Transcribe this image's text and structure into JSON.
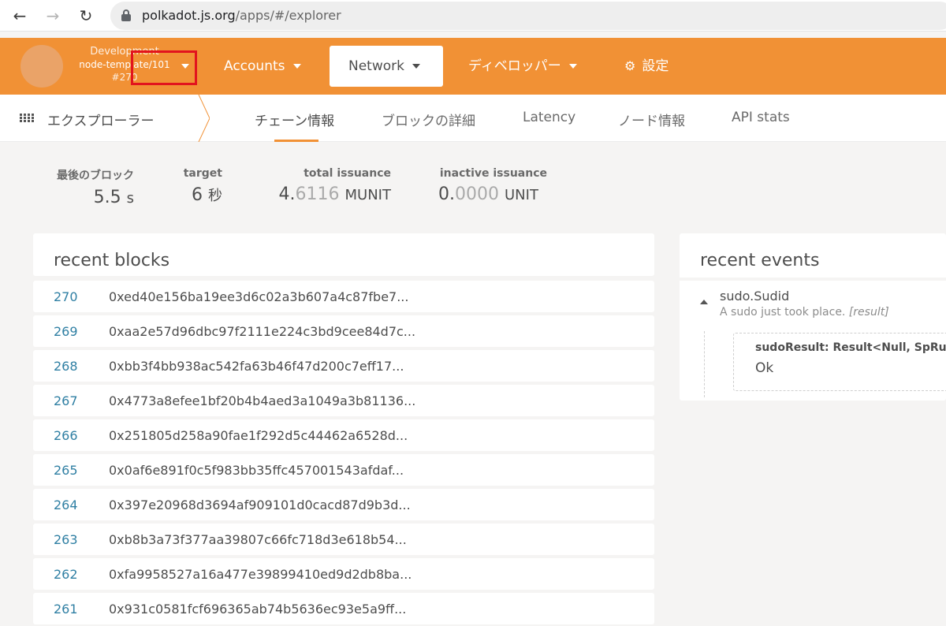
{
  "browser": {
    "url_host": "polkadot.js.org",
    "url_path": "/apps/#/explorer"
  },
  "topnav": {
    "chain_name": "Development",
    "chain_spec": "node-template/101",
    "best_block": "#270",
    "menu": [
      {
        "label": "Accounts"
      },
      {
        "label": "Network"
      },
      {
        "label": "ディベロッパー"
      },
      {
        "label": "設定"
      }
    ]
  },
  "subnav": {
    "section": "エクスプローラー",
    "tabs": [
      {
        "label": "チェーン情報"
      },
      {
        "label": "ブロックの詳細"
      },
      {
        "label": "Latency"
      },
      {
        "label": "ノード情報"
      },
      {
        "label": "API stats"
      }
    ]
  },
  "summary": [
    {
      "label": "最後のブロック",
      "value_main": "5.5",
      "value_light": "",
      "unit": "s"
    },
    {
      "label": "target",
      "value_main": "6",
      "value_light": "",
      "unit": "秒"
    },
    {
      "label": "total issuance",
      "value_main": "4.",
      "value_light": "6116",
      "unit": "MUNIT"
    },
    {
      "label": "inactive issuance",
      "value_main": "0.",
      "value_light": "0000",
      "unit": "UNIT"
    }
  ],
  "recent_blocks": {
    "title": "recent blocks",
    "rows": [
      {
        "number": "270",
        "hash": "0xed40e156ba19ee3d6c02a3b607a4c87fbe7..."
      },
      {
        "number": "269",
        "hash": "0xaa2e57d96dbc97f2111e224c3bd9cee84d7c..."
      },
      {
        "number": "268",
        "hash": "0xbb3f4bb938ac542fa63b46f47d200c7eff17..."
      },
      {
        "number": "267",
        "hash": "0x4773a8efee1bf20b4b4aed3a1049a3b81136..."
      },
      {
        "number": "266",
        "hash": "0x251805d258a90fae1f292d5c44462a6528d..."
      },
      {
        "number": "265",
        "hash": "0x0af6e891f0c5f983bb35ffc457001543afdaf..."
      },
      {
        "number": "264",
        "hash": "0x397e20968d3694af909101d0cacd87d9b3d..."
      },
      {
        "number": "263",
        "hash": "0xb8b3a73f377aa39807c66fc718d3e618b54..."
      },
      {
        "number": "262",
        "hash": "0xfa9958527a16a477e39899410ed9d2db8ba..."
      },
      {
        "number": "261",
        "hash": "0x931c0581fcf696365ab74b5636ec93e5a9ff..."
      }
    ]
  },
  "recent_events": {
    "title": "recent events",
    "event_name": "sudo.Sudid",
    "event_desc": "A sudo just took place.",
    "event_desc_tag": "[result]",
    "detail_label": "sudoResult: Result<Null, SpRuntimeDispatchError>",
    "detail_value": "Ok"
  },
  "colors": {
    "accent": "#f19135",
    "highlight": "#e2141e",
    "link": "#2f7fa3"
  }
}
